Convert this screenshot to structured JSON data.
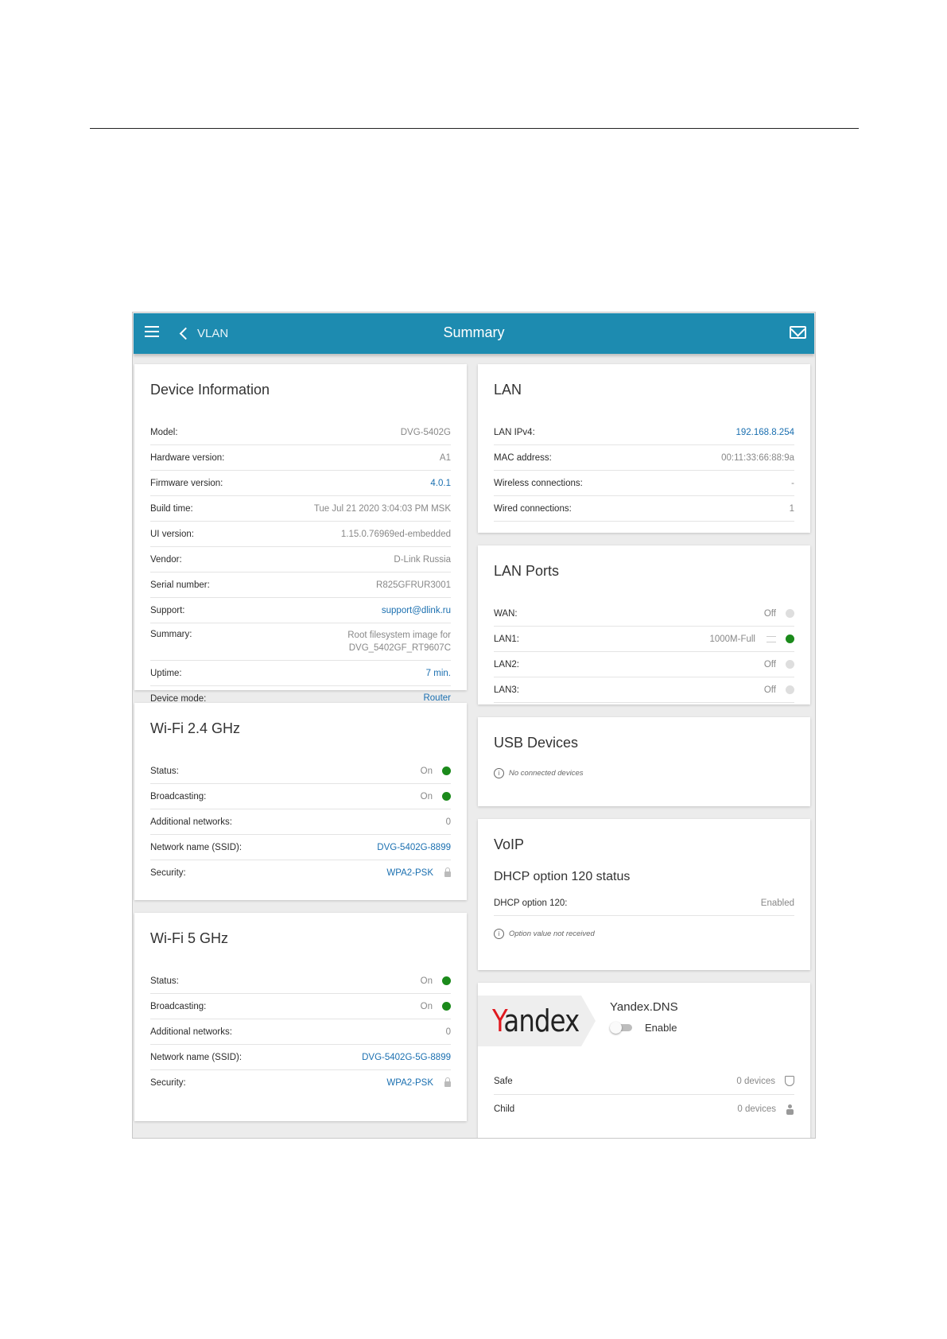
{
  "header": {
    "back_label": "VLAN",
    "title": "Summary"
  },
  "device_info": {
    "title": "Device Information",
    "rows": [
      {
        "label": "Model:",
        "value": "DVG-5402G"
      },
      {
        "label": "Hardware version:",
        "value": "A1"
      },
      {
        "label": "Firmware version:",
        "value": "4.0.1"
      },
      {
        "label": "Build time:",
        "value": "Tue Jul 21 2020 3:04:03 PM MSK"
      },
      {
        "label": "UI version:",
        "value": "1.15.0.76969ed-embedded"
      },
      {
        "label": "Vendor:",
        "value": "D-Link Russia"
      },
      {
        "label": "Serial number:",
        "value": "R825GFRUR3001"
      },
      {
        "label": "Support:",
        "value": "support@dlink.ru"
      },
      {
        "label": "Summary:",
        "value_line1": "Root filesystem image for",
        "value_line2": "DVG_5402GF_RT9607C"
      },
      {
        "label": "Uptime:",
        "value": "7 min."
      },
      {
        "label": "Device mode:",
        "value": "Router"
      }
    ]
  },
  "lan": {
    "title": "LAN",
    "rows": [
      {
        "label": "LAN IPv4:",
        "value": "192.168.8.254"
      },
      {
        "label": "MAC address:",
        "value": "00:11:33:66:88:9a"
      },
      {
        "label": "Wireless connections:",
        "value": "-"
      },
      {
        "label": "Wired connections:",
        "value": "1"
      }
    ]
  },
  "lan_ports": {
    "title": "LAN Ports",
    "rows": [
      {
        "label": "WAN:",
        "value": "Off"
      },
      {
        "label": "LAN1:",
        "value": "1000M-Full"
      },
      {
        "label": "LAN2:",
        "value": "Off"
      },
      {
        "label": "LAN3:",
        "value": "Off"
      }
    ]
  },
  "usb": {
    "title": "USB Devices",
    "info": "No connected devices"
  },
  "voip": {
    "title": "VoIP",
    "subtitle": "DHCP option 120 status",
    "row": {
      "label": "DHCP option 120:",
      "value": "Enabled"
    },
    "info": "Option value not received"
  },
  "wifi24": {
    "title": "Wi-Fi 2.4 GHz",
    "rows": [
      {
        "label": "Status:",
        "value": "On"
      },
      {
        "label": "Broadcasting:",
        "value": "On"
      },
      {
        "label": "Additional networks:",
        "value": "0"
      },
      {
        "label": "Network name (SSID):",
        "value": "DVG-5402G-8899"
      },
      {
        "label": "Security:",
        "value": "WPA2-PSK"
      }
    ]
  },
  "wifi5": {
    "title": "Wi-Fi 5 GHz",
    "rows": [
      {
        "label": "Status:",
        "value": "On"
      },
      {
        "label": "Broadcasting:",
        "value": "On"
      },
      {
        "label": "Additional networks:",
        "value": "0"
      },
      {
        "label": "Network name (SSID):",
        "value": "DVG-5402G-5G-8899"
      },
      {
        "label": "Security:",
        "value": "WPA2-PSK"
      }
    ]
  },
  "yandex": {
    "logo_first": "Y",
    "logo_rest": "andex",
    "title": "Yandex.DNS",
    "toggle_label": "Enable",
    "toggle_on": false,
    "rows": [
      {
        "label": "Safe",
        "value": "0 devices",
        "icon": "shield-icon"
      },
      {
        "label": "Child",
        "value": "0 devices",
        "icon": "child-icon"
      }
    ]
  },
  "colors": {
    "appbar": "#1d8bb0",
    "link": "#1a6fb0",
    "status_on": "#1b8a1b",
    "status_off": "#dedede",
    "yandex_red": "#e0191f"
  }
}
